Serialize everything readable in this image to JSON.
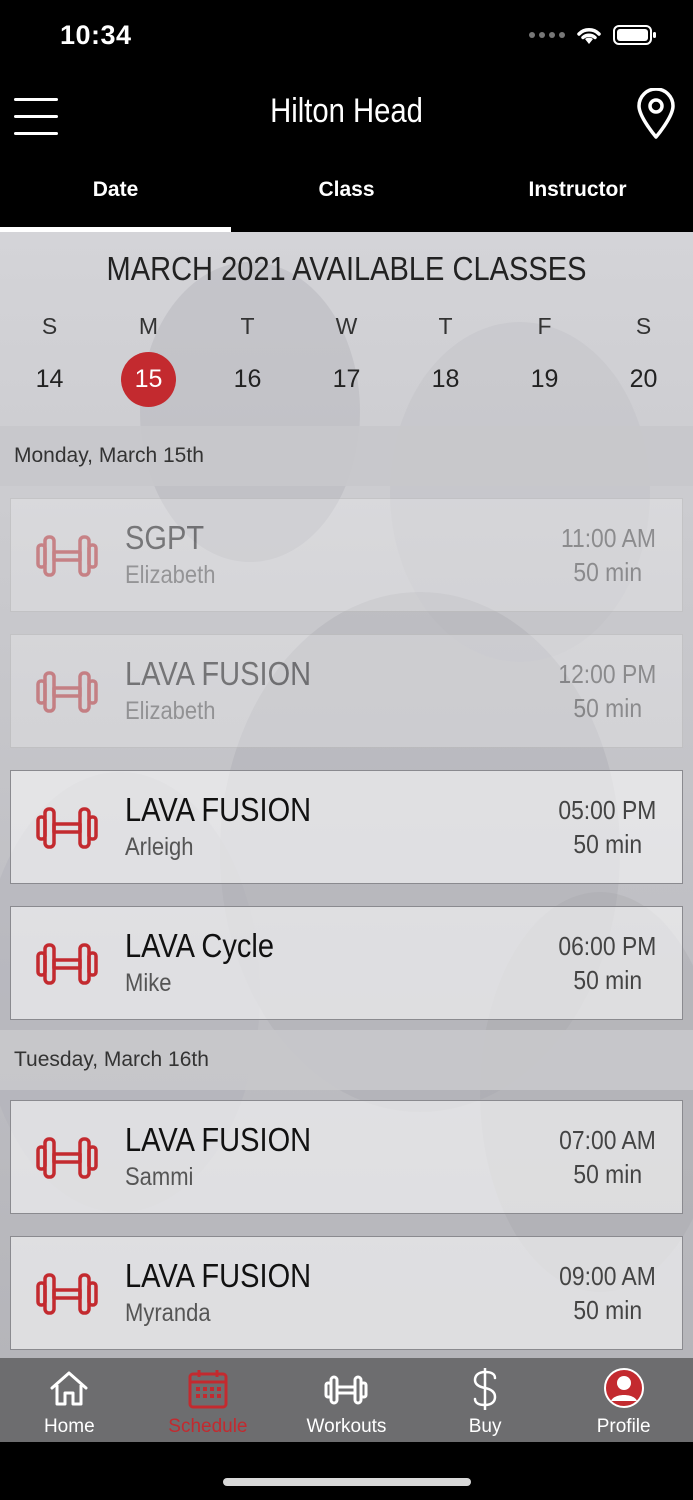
{
  "status": {
    "time": "10:34"
  },
  "header": {
    "title": "Hilton Head"
  },
  "tabs": [
    {
      "label": "Date",
      "active": true
    },
    {
      "label": "Class",
      "active": false
    },
    {
      "label": "Instructor",
      "active": false
    }
  ],
  "calendar": {
    "title": "MARCH 2021 AVAILABLE CLASSES",
    "weekdays": [
      "S",
      "M",
      "T",
      "W",
      "T",
      "F",
      "S"
    ],
    "days": [
      "14",
      "15",
      "16",
      "17",
      "18",
      "19",
      "20"
    ],
    "selected_day": "15"
  },
  "sections": [
    {
      "heading": "Monday, March 15th",
      "classes": [
        {
          "name": "SGPT",
          "instructor": "Elizabeth",
          "time": "11:00 AM",
          "duration": "50 min",
          "past": true
        },
        {
          "name": "LAVA FUSION",
          "instructor": "Elizabeth",
          "time": "12:00 PM",
          "duration": "50 min",
          "past": true
        },
        {
          "name": "LAVA FUSION",
          "instructor": "Arleigh",
          "time": "05:00 PM",
          "duration": "50 min",
          "past": false
        },
        {
          "name": "LAVA Cycle",
          "instructor": "Mike",
          "time": "06:00 PM",
          "duration": "50 min",
          "past": false
        }
      ]
    },
    {
      "heading": "Tuesday, March 16th",
      "classes": [
        {
          "name": "LAVA FUSION",
          "instructor": "Sammi",
          "time": "07:00 AM",
          "duration": "50 min",
          "past": false
        },
        {
          "name": "LAVA FUSION",
          "instructor": "Myranda",
          "time": "09:00 AM",
          "duration": "50 min",
          "past": false
        }
      ]
    }
  ],
  "tabbar": {
    "items": [
      {
        "label": "Home",
        "icon": "home-icon",
        "active": false
      },
      {
        "label": "Schedule",
        "icon": "calendar-icon",
        "active": true
      },
      {
        "label": "Workouts",
        "icon": "dumbbell-icon",
        "active": false
      },
      {
        "label": "Buy",
        "icon": "dollar-icon",
        "active": false
      },
      {
        "label": "Profile",
        "icon": "profile-icon",
        "active": false
      }
    ]
  },
  "colors": {
    "accent": "#c32a2f",
    "header_bg": "#000000",
    "tabbar_bg": "#6d6d6f"
  }
}
